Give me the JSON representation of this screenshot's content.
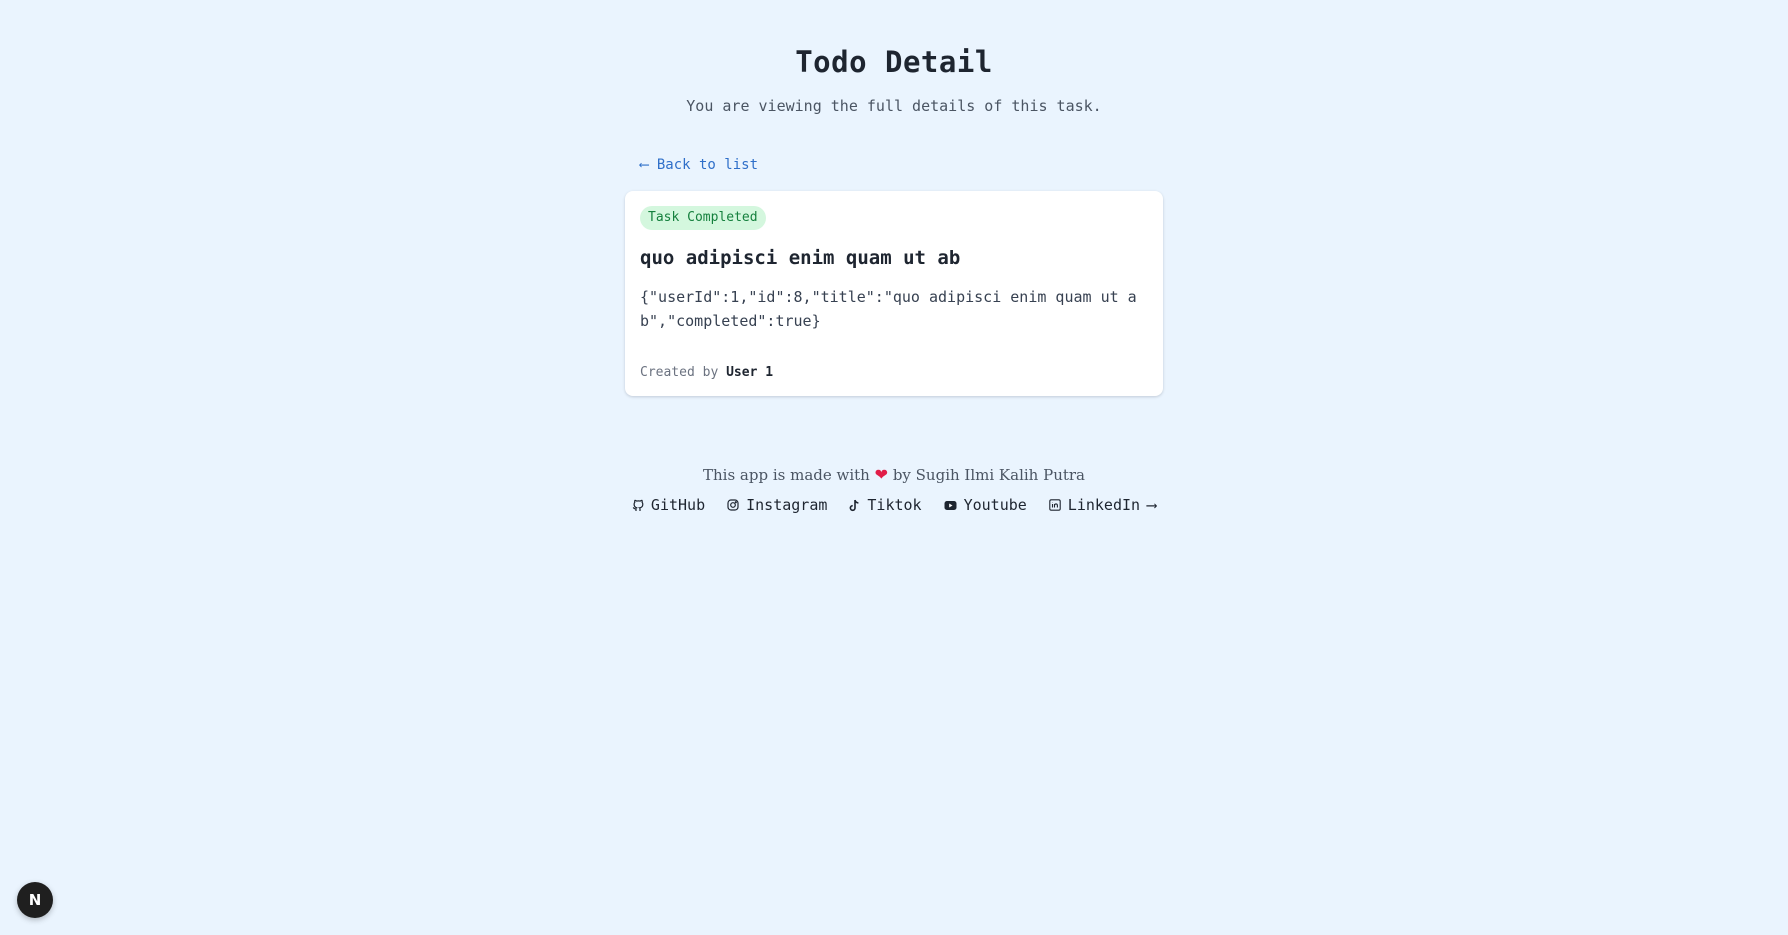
{
  "header": {
    "title": "Todo Detail",
    "subtitle": "You are viewing the full details of this task."
  },
  "nav": {
    "back_label": "⟵ Back to list"
  },
  "task": {
    "status_badge": "Task Completed",
    "title": "quo adipisci enim quam ut ab",
    "raw_json": "{\"userId\":1,\"id\":8,\"title\":\"quo adipisci enim quam ut ab\",\"completed\":true}",
    "created_prefix": "Created by",
    "created_user": "User 1"
  },
  "footer": {
    "credit_before": "This app is made with",
    "credit_icon": "heart-icon",
    "credit_after": "by Sugih Ilmi Kalih Putra",
    "links": [
      {
        "label": "GitHub",
        "icon": "github-icon"
      },
      {
        "label": "Instagram",
        "icon": "instagram-icon"
      },
      {
        "label": "Tiktok",
        "icon": "tiktok-icon"
      },
      {
        "label": "Youtube",
        "icon": "youtube-icon"
      },
      {
        "label": "LinkedIn",
        "icon": "linkedin-icon",
        "trailing": "⟶"
      }
    ]
  },
  "dev_badge": {
    "label": "N"
  },
  "colors": {
    "background": "#eaf4fe",
    "link": "#2f6fc9",
    "badge_bg": "#d4f7de",
    "badge_text": "#15803d",
    "heart": "#e11d48"
  }
}
